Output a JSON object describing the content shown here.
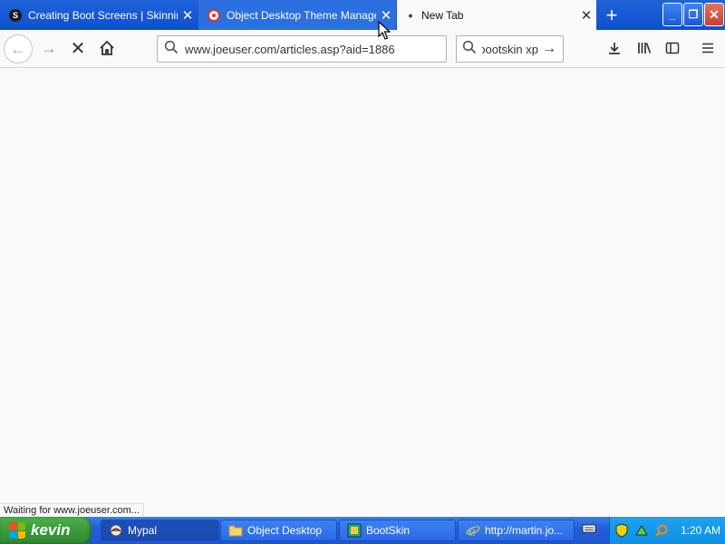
{
  "tabs": [
    {
      "title": "Creating Boot Screens | Skinning",
      "favicon": "S",
      "close": "✕"
    },
    {
      "title": "Object Desktop Theme Manager",
      "favicon": "",
      "close": "✕"
    },
    {
      "title": "New Tab",
      "favicon": "•",
      "close": "✕"
    }
  ],
  "new_tab": "+",
  "window": {
    "minimize": "_",
    "maximize": "❐",
    "close": "✕"
  },
  "nav": {
    "back": "←",
    "forward": "→",
    "stop": "✕",
    "home": "⌂",
    "url": "www.joeuser.com/articles.asp?aid=1886",
    "search_query": "bootskin xp",
    "search_go": "→",
    "search_icon": "⚲",
    "downloads": "⤓",
    "library": "|||\\",
    "sidebar": "▥",
    "menu": "≡"
  },
  "status_text": "Waiting for www.joeuser.com...",
  "taskbar": {
    "start_label": "kevin",
    "buttons": [
      {
        "label": "Mypal",
        "icon": "mypal-icon"
      },
      {
        "label": "Object Desktop",
        "icon": "folder-icon"
      },
      {
        "label": "BootSkin",
        "icon": "bootskin-icon"
      },
      {
        "label": "http://martin.jo...",
        "icon": "ie-icon"
      }
    ],
    "clock": "1:20 AM"
  }
}
